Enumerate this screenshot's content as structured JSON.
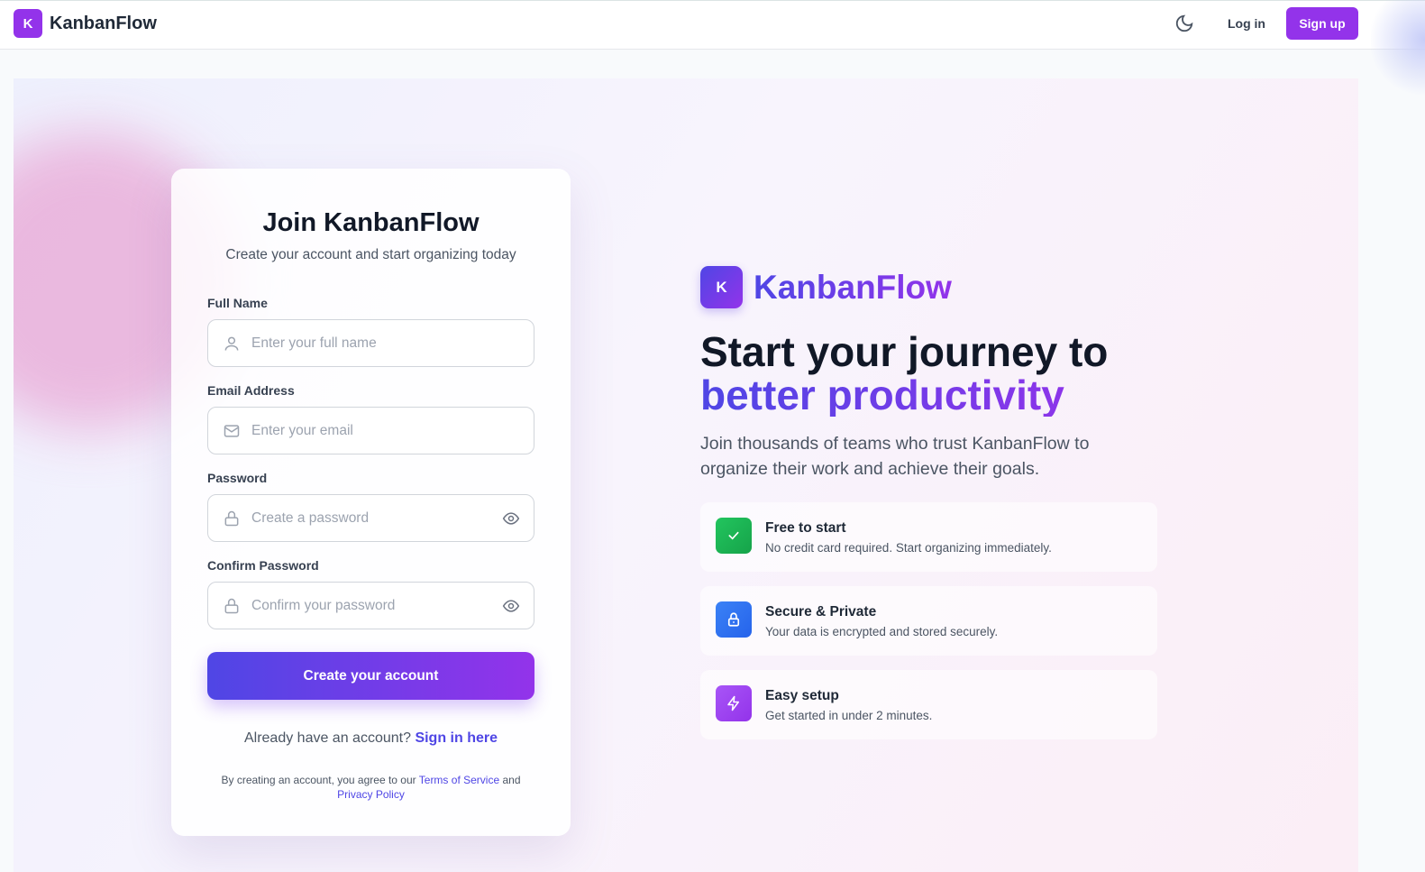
{
  "nav": {
    "brand": "KanbanFlow",
    "logo_letter": "K",
    "theme_icon": "moon-icon",
    "login": "Log in",
    "signup": "Sign up",
    "accent": "#9333ea"
  },
  "form": {
    "title": "Join KanbanFlow",
    "subtitle": "Create your account and start organizing today",
    "fields": [
      {
        "label": "Full Name",
        "placeholder": "Enter your full name",
        "icon": "user-icon"
      },
      {
        "label": "Email Address",
        "placeholder": "Enter your email",
        "icon": "mail-icon"
      },
      {
        "label": "Password",
        "placeholder": "Create a password",
        "icon": "lock-icon"
      },
      {
        "label": "Confirm Password",
        "placeholder": "Confirm your password",
        "icon": "lock-icon"
      }
    ],
    "submit": "Create your account",
    "already": "Already have an account?",
    "signin": "Sign in here",
    "terms_prefix": "By creating an account, you agree to our",
    "terms": "Terms of Service",
    "and": "and",
    "privacy": "Privacy Policy"
  },
  "hero": {
    "logo_letter": "K",
    "brand": "KanbanFlow",
    "heading_line1": "Start your journey to",
    "heading_line2": "better productivity",
    "paragraph": "Join thousands of teams who trust KanbanFlow to organize their work and achieve their goals.",
    "features": [
      {
        "title": "Free to start",
        "desc": "No credit card required. Start organizing immediately.",
        "icon": "check-icon",
        "color": "#16a34a"
      },
      {
        "title": "Secure & Private",
        "desc": "Your data is encrypted and stored securely.",
        "icon": "lock-icon",
        "color": "#2563eb"
      },
      {
        "title": "Easy setup",
        "desc": "Get started in under 2 minutes.",
        "icon": "lightning-icon",
        "color": "#9333ea"
      }
    ]
  }
}
